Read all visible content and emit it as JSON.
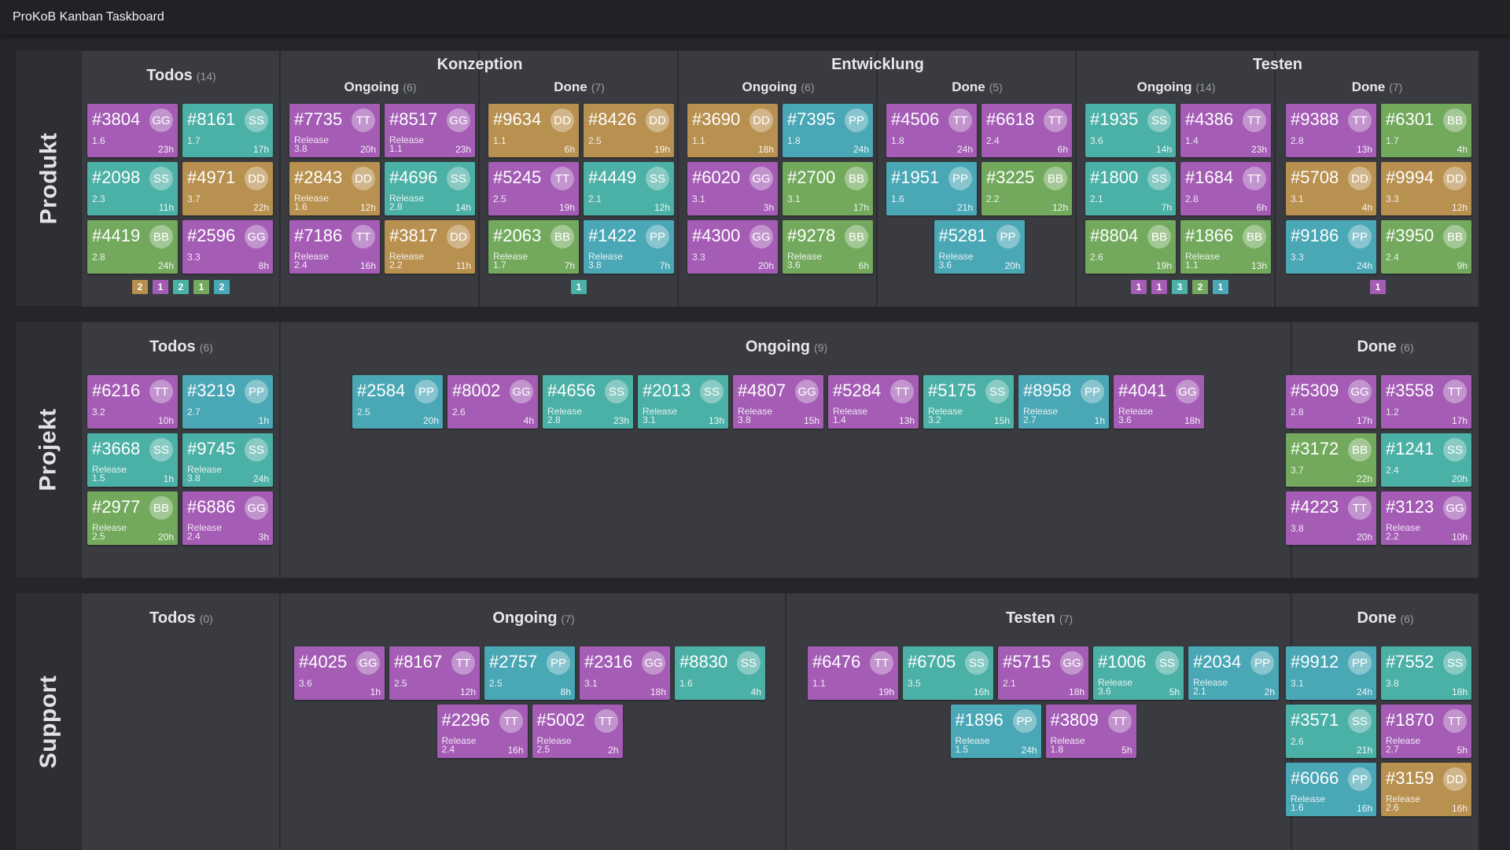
{
  "app": {
    "title": "ProKoB Kanban Taskboard"
  },
  "colors": {
    "purple": "#a45cb5",
    "teal": "#4bb0a5",
    "orange": "#b8904f",
    "green": "#72a95d",
    "cyan": "#4aa7b5",
    "background": "#24262b",
    "lane": "#35373c"
  },
  "lanes": {
    "produkt": {
      "label": "Produkt",
      "todos": {
        "title": "Todos",
        "count": "(14)",
        "cards": [
          {
            "id": "#3804",
            "user": "GG",
            "size": "1.6",
            "hours": "23h",
            "color": "purple"
          },
          {
            "id": "#8161",
            "user": "SS",
            "size": "1.7",
            "hours": "17h",
            "color": "teal"
          },
          {
            "id": "#2098",
            "user": "SS",
            "size": "2.3",
            "hours": "11h",
            "color": "teal"
          },
          {
            "id": "#4971",
            "user": "DD",
            "size": "3.7",
            "hours": "22h",
            "color": "orange"
          },
          {
            "id": "#4419",
            "user": "BB",
            "size": "2.8",
            "hours": "24h",
            "color": "green"
          },
          {
            "id": "#2596",
            "user": "GG",
            "size": "3.3",
            "hours": "8h",
            "color": "purple"
          }
        ],
        "chips": [
          {
            "n": "2",
            "color": "orange"
          },
          {
            "n": "1",
            "color": "purple"
          },
          {
            "n": "2",
            "color": "teal"
          },
          {
            "n": "1",
            "color": "green"
          },
          {
            "n": "2",
            "color": "cyan"
          }
        ]
      },
      "konzeption": {
        "title": "Konzeption",
        "ongoing": {
          "title": "Ongoing",
          "count": "(6)",
          "cards": [
            {
              "id": "#7735",
              "user": "TT",
              "release": "Release",
              "size": "3.8",
              "hours": "20h",
              "color": "purple"
            },
            {
              "id": "#8517",
              "user": "GG",
              "release": "Release",
              "size": "1.1",
              "hours": "23h",
              "color": "purple"
            },
            {
              "id": "#2843",
              "user": "DD",
              "release": "Release",
              "size": "1.6",
              "hours": "12h",
              "color": "orange"
            },
            {
              "id": "#4696",
              "user": "SS",
              "release": "Release",
              "size": "2.8",
              "hours": "14h",
              "color": "teal"
            },
            {
              "id": "#7186",
              "user": "TT",
              "release": "Release",
              "size": "2.4",
              "hours": "16h",
              "color": "purple"
            },
            {
              "id": "#3817",
              "user": "DD",
              "release": "Release",
              "size": "2.2",
              "hours": "11h",
              "color": "orange"
            }
          ]
        },
        "done": {
          "title": "Done",
          "count": "(7)",
          "cards": [
            {
              "id": "#9634",
              "user": "DD",
              "size": "1.1",
              "hours": "6h",
              "color": "orange"
            },
            {
              "id": "#8426",
              "user": "DD",
              "size": "2.5",
              "hours": "19h",
              "color": "orange"
            },
            {
              "id": "#5245",
              "user": "TT",
              "size": "2.5",
              "hours": "19h",
              "color": "purple"
            },
            {
              "id": "#4449",
              "user": "SS",
              "size": "2.1",
              "hours": "12h",
              "color": "teal"
            },
            {
              "id": "#2063",
              "user": "BB",
              "release": "Release",
              "size": "1.7",
              "hours": "7h",
              "color": "green"
            },
            {
              "id": "#1422",
              "user": "PP",
              "release": "Release",
              "size": "3.8",
              "hours": "7h",
              "color": "cyan"
            }
          ],
          "chips": [
            {
              "n": "1",
              "color": "teal"
            }
          ]
        }
      },
      "entwicklung": {
        "title": "Entwicklung",
        "ongoing": {
          "title": "Ongoing",
          "count": "(6)",
          "cards": [
            {
              "id": "#3690",
              "user": "DD",
              "size": "1.1",
              "hours": "18h",
              "color": "orange"
            },
            {
              "id": "#7395",
              "user": "PP",
              "size": "1.8",
              "hours": "24h",
              "color": "cyan"
            },
            {
              "id": "#6020",
              "user": "GG",
              "size": "3.1",
              "hours": "3h",
              "color": "purple"
            },
            {
              "id": "#2700",
              "user": "BB",
              "size": "3.1",
              "hours": "17h",
              "color": "green"
            },
            {
              "id": "#4300",
              "user": "GG",
              "size": "3.3",
              "hours": "20h",
              "color": "purple"
            },
            {
              "id": "#9278",
              "user": "BB",
              "release": "Release",
              "size": "3.6",
              "hours": "6h",
              "color": "green"
            }
          ]
        },
        "done": {
          "title": "Done",
          "count": "(5)",
          "cards": [
            {
              "id": "#4506",
              "user": "TT",
              "size": "1.8",
              "hours": "24h",
              "color": "purple"
            },
            {
              "id": "#6618",
              "user": "TT",
              "size": "2.4",
              "hours": "6h",
              "color": "purple"
            },
            {
              "id": "#1951",
              "user": "PP",
              "size": "1.6",
              "hours": "21h",
              "color": "cyan"
            },
            {
              "id": "#3225",
              "user": "BB",
              "size": "2.2",
              "hours": "12h",
              "color": "green"
            },
            {
              "id": "#5281",
              "user": "PP",
              "release": "Release",
              "size": "3.6",
              "hours": "20h",
              "color": "cyan"
            }
          ]
        }
      },
      "testen": {
        "title": "Testen",
        "ongoing": {
          "title": "Ongoing",
          "count": "(14)",
          "cards": [
            {
              "id": "#1935",
              "user": "SS",
              "size": "3.6",
              "hours": "14h",
              "color": "teal"
            },
            {
              "id": "#4386",
              "user": "TT",
              "size": "1.4",
              "hours": "23h",
              "color": "purple"
            },
            {
              "id": "#1800",
              "user": "SS",
              "size": "2.1",
              "hours": "7h",
              "color": "teal"
            },
            {
              "id": "#1684",
              "user": "TT",
              "size": "2.8",
              "hours": "6h",
              "color": "purple"
            },
            {
              "id": "#8804",
              "user": "BB",
              "size": "2.6",
              "hours": "19h",
              "color": "green"
            },
            {
              "id": "#1866",
              "user": "BB",
              "release": "Release",
              "size": "1.1",
              "hours": "13h",
              "color": "green"
            }
          ],
          "chips": [
            {
              "n": "1",
              "color": "purple"
            },
            {
              "n": "1",
              "color": "purple"
            },
            {
              "n": "3",
              "color": "teal"
            },
            {
              "n": "2",
              "color": "green"
            },
            {
              "n": "1",
              "color": "cyan"
            }
          ]
        },
        "done": {
          "title": "Done",
          "count": "(7)",
          "cards": [
            {
              "id": "#9388",
              "user": "TT",
              "size": "2.8",
              "hours": "13h",
              "color": "purple"
            },
            {
              "id": "#6301",
              "user": "BB",
              "size": "1.7",
              "hours": "4h",
              "color": "green"
            },
            {
              "id": "#5708",
              "user": "DD",
              "size": "3.1",
              "hours": "4h",
              "color": "orange"
            },
            {
              "id": "#9994",
              "user": "DD",
              "size": "3.3",
              "hours": "12h",
              "color": "orange"
            },
            {
              "id": "#9186",
              "user": "PP",
              "size": "3.3",
              "hours": "24h",
              "color": "cyan"
            },
            {
              "id": "#3950",
              "user": "BB",
              "size": "2.4",
              "hours": "9h",
              "color": "green"
            }
          ],
          "chips": [
            {
              "n": "1",
              "color": "purple"
            }
          ]
        }
      }
    },
    "projekt": {
      "label": "Projekt",
      "todos": {
        "title": "Todos",
        "count": "(6)",
        "cards": [
          {
            "id": "#6216",
            "user": "TT",
            "size": "3.2",
            "hours": "10h",
            "color": "purple"
          },
          {
            "id": "#3219",
            "user": "PP",
            "size": "2.7",
            "hours": "1h",
            "color": "cyan"
          },
          {
            "id": "#3668",
            "user": "SS",
            "release": "Release",
            "size": "1.5",
            "hours": "1h",
            "color": "teal"
          },
          {
            "id": "#9745",
            "user": "SS",
            "release": "Release",
            "size": "3.8",
            "hours": "24h",
            "color": "teal"
          },
          {
            "id": "#2977",
            "user": "BB",
            "release": "Release",
            "size": "2.5",
            "hours": "20h",
            "color": "green"
          },
          {
            "id": "#6886",
            "user": "GG",
            "release": "Release",
            "size": "2.4",
            "hours": "3h",
            "color": "purple"
          }
        ]
      },
      "ongoing": {
        "title": "Ongoing",
        "count": "(9)",
        "cards": [
          {
            "id": "#2584",
            "user": "PP",
            "size": "2.5",
            "hours": "20h",
            "color": "cyan"
          },
          {
            "id": "#8002",
            "user": "GG",
            "size": "2.6",
            "hours": "4h",
            "color": "purple"
          },
          {
            "id": "#4656",
            "user": "SS",
            "release": "Release",
            "size": "2.8",
            "hours": "23h",
            "color": "teal"
          },
          {
            "id": "#2013",
            "user": "SS",
            "release": "Release",
            "size": "3.1",
            "hours": "13h",
            "color": "teal"
          },
          {
            "id": "#4807",
            "user": "GG",
            "release": "Release",
            "size": "3.8",
            "hours": "15h",
            "color": "purple"
          },
          {
            "id": "#5284",
            "user": "TT",
            "release": "Release",
            "size": "1.4",
            "hours": "13h",
            "color": "purple"
          },
          {
            "id": "#5175",
            "user": "SS",
            "release": "Release",
            "size": "3.2",
            "hours": "15h",
            "color": "teal"
          },
          {
            "id": "#8958",
            "user": "PP",
            "release": "Release",
            "size": "2.7",
            "hours": "1h",
            "color": "cyan"
          },
          {
            "id": "#4041",
            "user": "GG",
            "release": "Release",
            "size": "3.6",
            "hours": "18h",
            "color": "purple"
          }
        ]
      },
      "done": {
        "title": "Done",
        "count": "(6)",
        "cards": [
          {
            "id": "#5309",
            "user": "GG",
            "size": "2.8",
            "hours": "17h",
            "color": "purple"
          },
          {
            "id": "#3558",
            "user": "TT",
            "size": "1.2",
            "hours": "17h",
            "color": "purple"
          },
          {
            "id": "#3172",
            "user": "BB",
            "size": "3.7",
            "hours": "22h",
            "color": "green"
          },
          {
            "id": "#1241",
            "user": "SS",
            "size": "2.4",
            "hours": "20h",
            "color": "teal"
          },
          {
            "id": "#4223",
            "user": "TT",
            "size": "3.8",
            "hours": "20h",
            "color": "purple"
          },
          {
            "id": "#3123",
            "user": "GG",
            "release": "Release",
            "size": "2.2",
            "hours": "10h",
            "color": "purple"
          }
        ]
      }
    },
    "support": {
      "label": "Support",
      "todos": {
        "title": "Todos",
        "count": "(0)",
        "cards": []
      },
      "ongoing": {
        "title": "Ongoing",
        "count": "(7)",
        "cards": [
          {
            "id": "#4025",
            "user": "GG",
            "size": "3.6",
            "hours": "1h",
            "color": "purple"
          },
          {
            "id": "#8167",
            "user": "TT",
            "size": "2.5",
            "hours": "12h",
            "color": "purple"
          },
          {
            "id": "#2757",
            "user": "PP",
            "size": "2.5",
            "hours": "8h",
            "color": "cyan"
          },
          {
            "id": "#2316",
            "user": "GG",
            "size": "3.1",
            "hours": "18h",
            "color": "purple"
          },
          {
            "id": "#8830",
            "user": "SS",
            "size": "1.6",
            "hours": "4h",
            "color": "teal"
          },
          {
            "id": "#2296",
            "user": "TT",
            "release": "Release",
            "size": "2.4",
            "hours": "16h",
            "color": "purple"
          },
          {
            "id": "#5002",
            "user": "TT",
            "release": "Release",
            "size": "2.5",
            "hours": "2h",
            "color": "purple"
          }
        ]
      },
      "testen": {
        "title": "Testen",
        "count": "(7)",
        "cards": [
          {
            "id": "#6476",
            "user": "TT",
            "size": "1.1",
            "hours": "19h",
            "color": "purple"
          },
          {
            "id": "#6705",
            "user": "SS",
            "size": "3.5",
            "hours": "16h",
            "color": "teal"
          },
          {
            "id": "#5715",
            "user": "GG",
            "size": "2.1",
            "hours": "18h",
            "color": "purple"
          },
          {
            "id": "#1006",
            "user": "SS",
            "release": "Release",
            "size": "3.6",
            "hours": "5h",
            "color": "teal"
          },
          {
            "id": "#2034",
            "user": "PP",
            "release": "Release",
            "size": "2.1",
            "hours": "2h",
            "color": "cyan"
          },
          {
            "id": "#1896",
            "user": "PP",
            "release": "Release",
            "size": "1.5",
            "hours": "24h",
            "color": "cyan"
          },
          {
            "id": "#3809",
            "user": "TT",
            "release": "Release",
            "size": "1.8",
            "hours": "5h",
            "color": "purple"
          }
        ]
      },
      "done": {
        "title": "Done",
        "count": "(6)",
        "cards": [
          {
            "id": "#9912",
            "user": "PP",
            "size": "3.1",
            "hours": "24h",
            "color": "cyan"
          },
          {
            "id": "#7552",
            "user": "SS",
            "size": "3.8",
            "hours": "18h",
            "color": "teal"
          },
          {
            "id": "#3571",
            "user": "SS",
            "size": "2.6",
            "hours": "21h",
            "color": "teal"
          },
          {
            "id": "#1870",
            "user": "TT",
            "release": "Release",
            "size": "2.7",
            "hours": "5h",
            "color": "purple"
          },
          {
            "id": "#6066",
            "user": "PP",
            "release": "Release",
            "size": "1.6",
            "hours": "16h",
            "color": "cyan"
          },
          {
            "id": "#3159",
            "user": "DD",
            "release": "Release",
            "size": "2.6",
            "hours": "16h",
            "color": "orange"
          }
        ]
      }
    }
  }
}
